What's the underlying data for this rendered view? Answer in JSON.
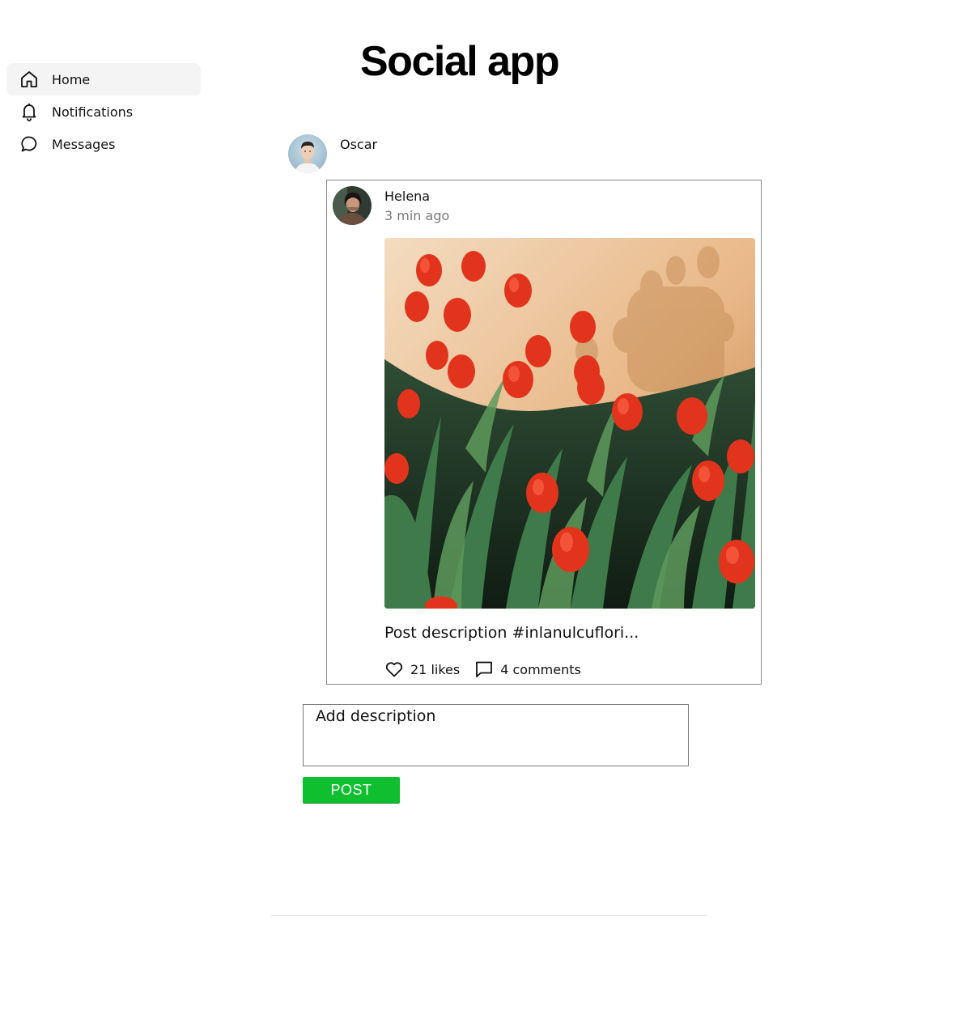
{
  "app": {
    "title": "Social app"
  },
  "sidebar": {
    "items": [
      {
        "label": "Home",
        "icon": "home-icon",
        "active": true
      },
      {
        "label": "Notifications",
        "icon": "bell-icon",
        "active": false
      },
      {
        "label": "Messages",
        "icon": "message-icon",
        "active": false
      }
    ]
  },
  "feed": {
    "author": {
      "name": "Oscar",
      "avatar": "avatar-oscar"
    },
    "post": {
      "user": "Helena",
      "time": "3 min ago",
      "image": "red-tulips-photo",
      "description": "Post description #inlanulcuflori...",
      "likes": "21 likes",
      "comments": "4 comments"
    }
  },
  "composer": {
    "placeholder": "Add description",
    "button_label": "POST"
  },
  "colors": {
    "accent_green": "#0fbf2f",
    "active_nav_bg": "#f4f4f4",
    "muted_text": "#7a7a7a",
    "border": "#8a8a8a"
  }
}
